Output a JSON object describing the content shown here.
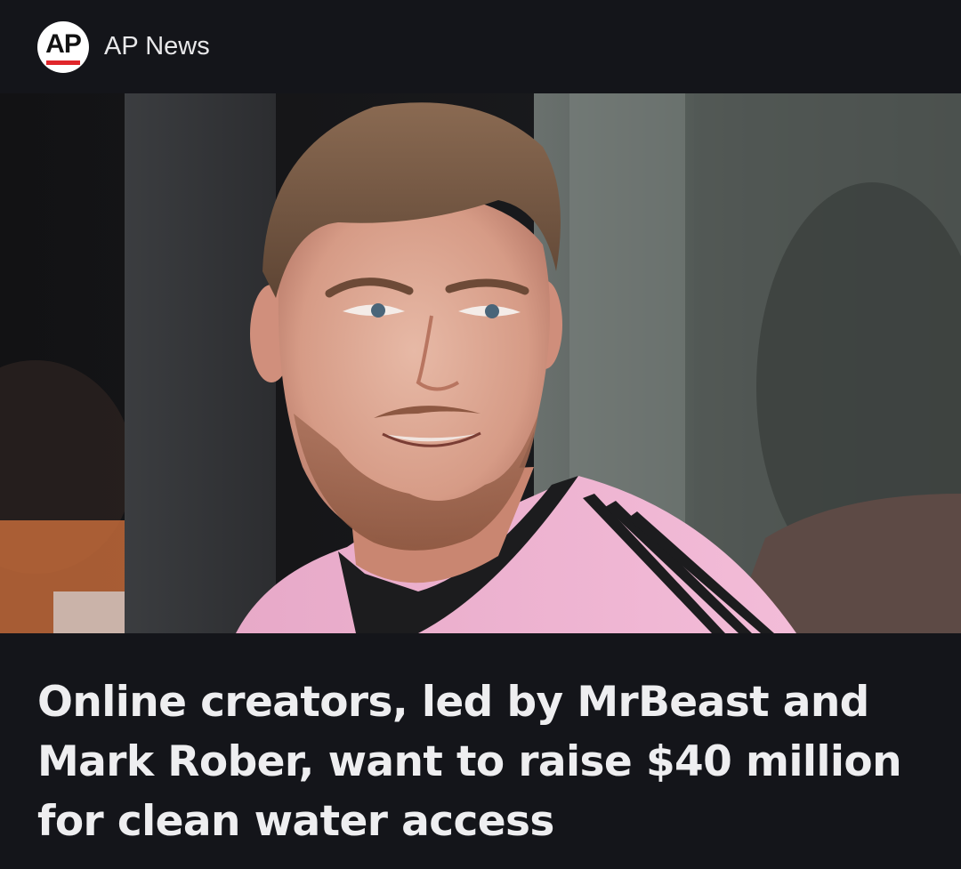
{
  "source": {
    "logo_text": "AP",
    "name": "AP News"
  },
  "article": {
    "headline": "Online creators, led by MrBeast and Mark Rober, want to raise $40 million for clean water access"
  },
  "colors": {
    "background": "#14151a",
    "text": "#eeeef0",
    "logo_red": "#e0262b"
  }
}
